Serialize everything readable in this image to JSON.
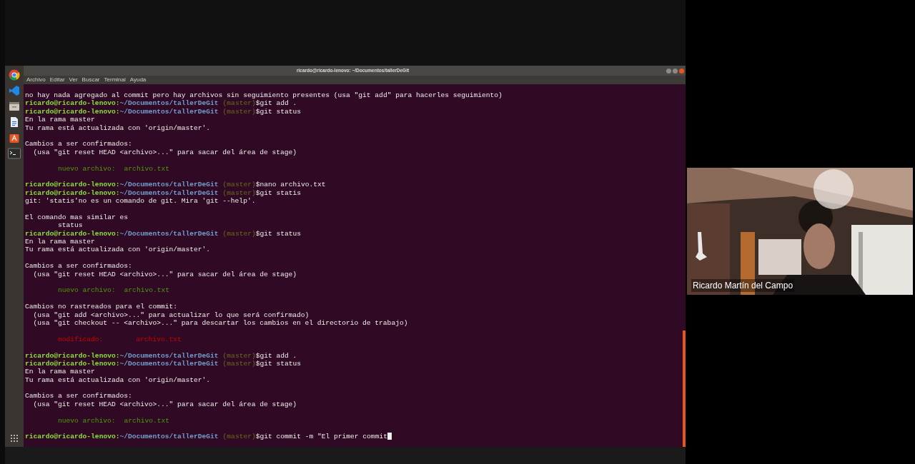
{
  "window": {
    "title": "ricardo@ricardo-lenovo: ~/Documentos/tallerDeGit"
  },
  "menu": [
    "Archivo",
    "Editar",
    "Ver",
    "Buscar",
    "Terminal",
    "Ayuda"
  ],
  "terminal": {
    "lines": [
      {
        "kind": "output",
        "text": "no hay nada agregado al commit pero hay archivos sin seguimiento presentes (usa \"git add\" para hacerles seguimiento)"
      },
      {
        "kind": "prompt",
        "user": "ricardo@ricardo-lenovo:",
        "path": "~/Documentos/tallerDeGit",
        "branch": "(master)",
        "command": "$git add ."
      },
      {
        "kind": "prompt",
        "user": "ricardo@ricardo-lenovo:",
        "path": "~/Documentos/tallerDeGit",
        "branch": "(master)",
        "command": "$git status"
      },
      {
        "kind": "output",
        "text": "En la rama master"
      },
      {
        "kind": "output",
        "text": "Tu rama está actualizada con 'origin/master'."
      },
      {
        "kind": "blank"
      },
      {
        "kind": "output",
        "text": "Cambios a ser confirmados:"
      },
      {
        "kind": "hint",
        "text": "(usa \"git reset HEAD <archivo>...\" para sacar del área de stage)"
      },
      {
        "kind": "blank"
      },
      {
        "kind": "staged",
        "label": "nuevo archivo:",
        "file": "archivo.txt"
      },
      {
        "kind": "blank"
      },
      {
        "kind": "prompt",
        "user": "ricardo@ricardo-lenovo:",
        "path": "~/Documentos/tallerDeGit",
        "branch": "(master)",
        "command": "$nano archivo.txt"
      },
      {
        "kind": "prompt",
        "user": "ricardo@ricardo-lenovo:",
        "path": "~/Documentos/tallerDeGit",
        "branch": "(master)",
        "command": "$git statis"
      },
      {
        "kind": "output",
        "text": "git: 'statis'no es un comando de git. Mira 'git --help'."
      },
      {
        "kind": "blank"
      },
      {
        "kind": "output",
        "text": "El comando mas similar es"
      },
      {
        "kind": "suggestion",
        "text": "status"
      },
      {
        "kind": "prompt",
        "user": "ricardo@ricardo-lenovo:",
        "path": "~/Documentos/tallerDeGit",
        "branch": "(master)",
        "command": "$git status"
      },
      {
        "kind": "output",
        "text": "En la rama master"
      },
      {
        "kind": "output",
        "text": "Tu rama está actualizada con 'origin/master'."
      },
      {
        "kind": "blank"
      },
      {
        "kind": "output",
        "text": "Cambios a ser confirmados:"
      },
      {
        "kind": "hint",
        "text": "(usa \"git reset HEAD <archivo>...\" para sacar del área de stage)"
      },
      {
        "kind": "blank"
      },
      {
        "kind": "staged",
        "label": "nuevo archivo:",
        "file": "archivo.txt"
      },
      {
        "kind": "blank"
      },
      {
        "kind": "output",
        "text": "Cambios no rastreados para el commit:"
      },
      {
        "kind": "hint",
        "text": "(usa \"git add <archivo>...\" para actualizar lo que será confirmado)"
      },
      {
        "kind": "hint",
        "text": "(usa \"git checkout -- <archivo>...\" para descartar los cambios en el directorio de trabajo)"
      },
      {
        "kind": "blank"
      },
      {
        "kind": "modified",
        "label": "modificado:",
        "file": "archivo.txt"
      },
      {
        "kind": "blank"
      },
      {
        "kind": "prompt",
        "user": "ricardo@ricardo-lenovo:",
        "path": "~/Documentos/tallerDeGit",
        "branch": "(master)",
        "command": "$git add ."
      },
      {
        "kind": "prompt",
        "user": "ricardo@ricardo-lenovo:",
        "path": "~/Documentos/tallerDeGit",
        "branch": "(master)",
        "command": "$git status"
      },
      {
        "kind": "output",
        "text": "En la rama master"
      },
      {
        "kind": "output",
        "text": "Tu rama está actualizada con 'origin/master'."
      },
      {
        "kind": "blank"
      },
      {
        "kind": "output",
        "text": "Cambios a ser confirmados:"
      },
      {
        "kind": "hint",
        "text": "(usa \"git reset HEAD <archivo>...\" para sacar del área de stage)"
      },
      {
        "kind": "blank"
      },
      {
        "kind": "staged",
        "label": "nuevo archivo:",
        "file": "archivo.txt"
      },
      {
        "kind": "blank"
      },
      {
        "kind": "prompt",
        "user": "ricardo@ricardo-lenovo:",
        "path": "~/Documentos/tallerDeGit",
        "branch": "(master)",
        "command": "$git commit -m \"El primer commit",
        "cursor": true
      }
    ]
  },
  "video": {
    "kind": "picture",
    "name": "Ricardo Martín del Campo"
  }
}
